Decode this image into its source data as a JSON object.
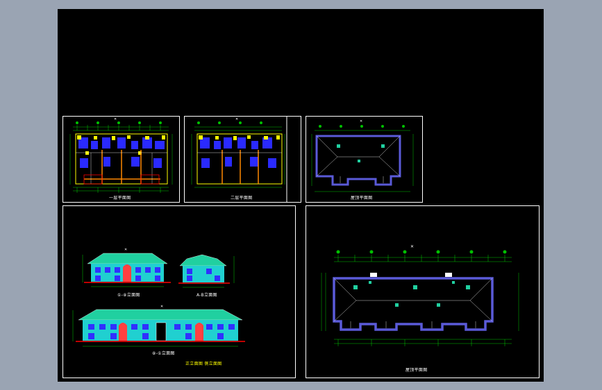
{
  "canvas": {
    "background": "#9aa4b3",
    "model_space_color": "#000000",
    "frame_color": "#ffffff"
  },
  "colors": {
    "grid": "#00c000",
    "dim": "#00ff00",
    "wall": "#ffff00",
    "column": "#ff8800",
    "room": "#2a2aff",
    "roof_outline": "#5a5ad8",
    "roof_fill": "#20d0a0",
    "facade_wall": "#20d0d0",
    "window": "#3030ff",
    "ground": "#ff0000",
    "text": "#ffffff"
  },
  "sheets": [
    {
      "name": "ground-floor-plan",
      "type": "plan",
      "caption": "一层平面图"
    },
    {
      "name": "second-floor-plan",
      "type": "plan",
      "caption": "二层平面图"
    },
    {
      "name": "roof-plan-small",
      "type": "roof",
      "caption": "屋顶平面图"
    },
    {
      "name": "elevations",
      "type": "elevation",
      "captions": [
        "①-⑧立面图",
        "A-B立面图",
        "⑧-①立面图",
        "正立面图 侧立面图"
      ]
    },
    {
      "name": "roof-plan-large",
      "type": "roof",
      "caption": "屋顶平面图"
    }
  ]
}
